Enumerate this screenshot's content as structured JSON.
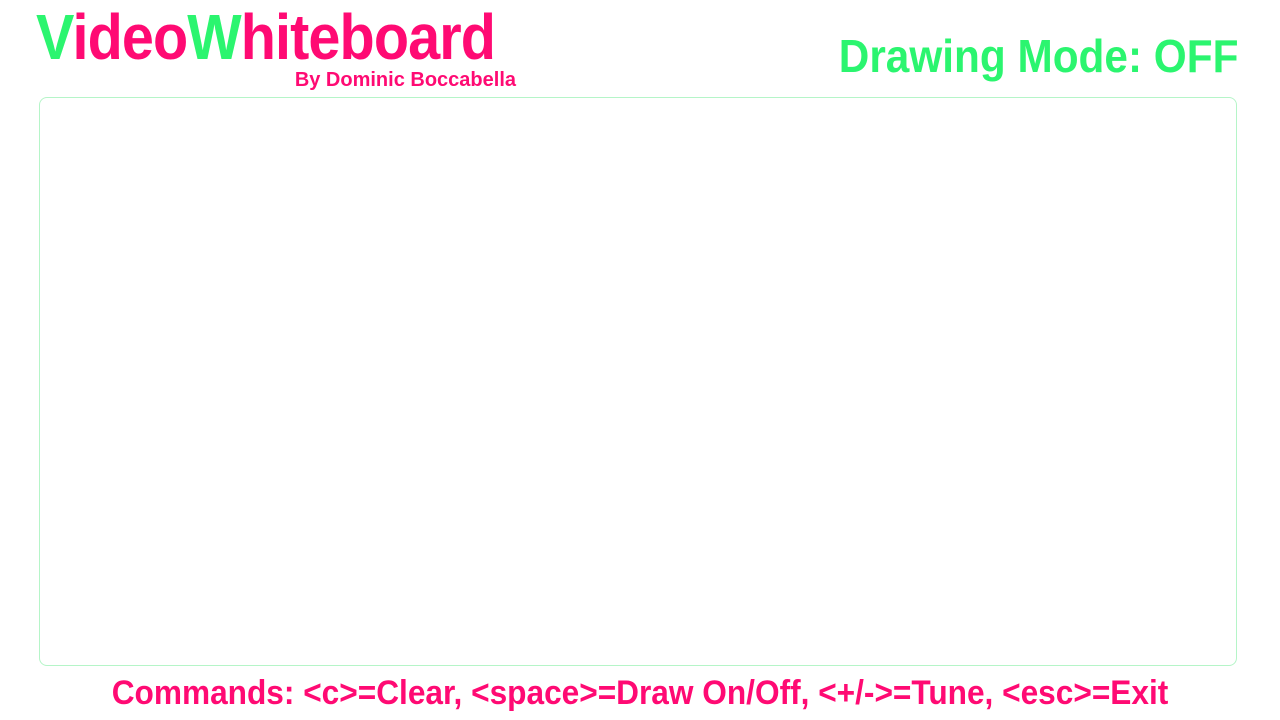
{
  "header": {
    "title_parts": [
      {
        "text": "V",
        "style": "accent"
      },
      {
        "text": "ideo",
        "style": "main"
      },
      {
        "text": "W",
        "style": "accent"
      },
      {
        "text": "hiteboard",
        "style": "main"
      }
    ],
    "byline": "By Dominic Boccabella",
    "mode_status": "Drawing Mode: OFF"
  },
  "footer": {
    "commands": "Commands: <c>=Clear, <space>=Draw On/Off, <+/->=Tune, <esc>=Exit"
  },
  "colors": {
    "accent": "#2bf56f",
    "main": "#ff0a73",
    "board_border": "#b5f5c8"
  }
}
